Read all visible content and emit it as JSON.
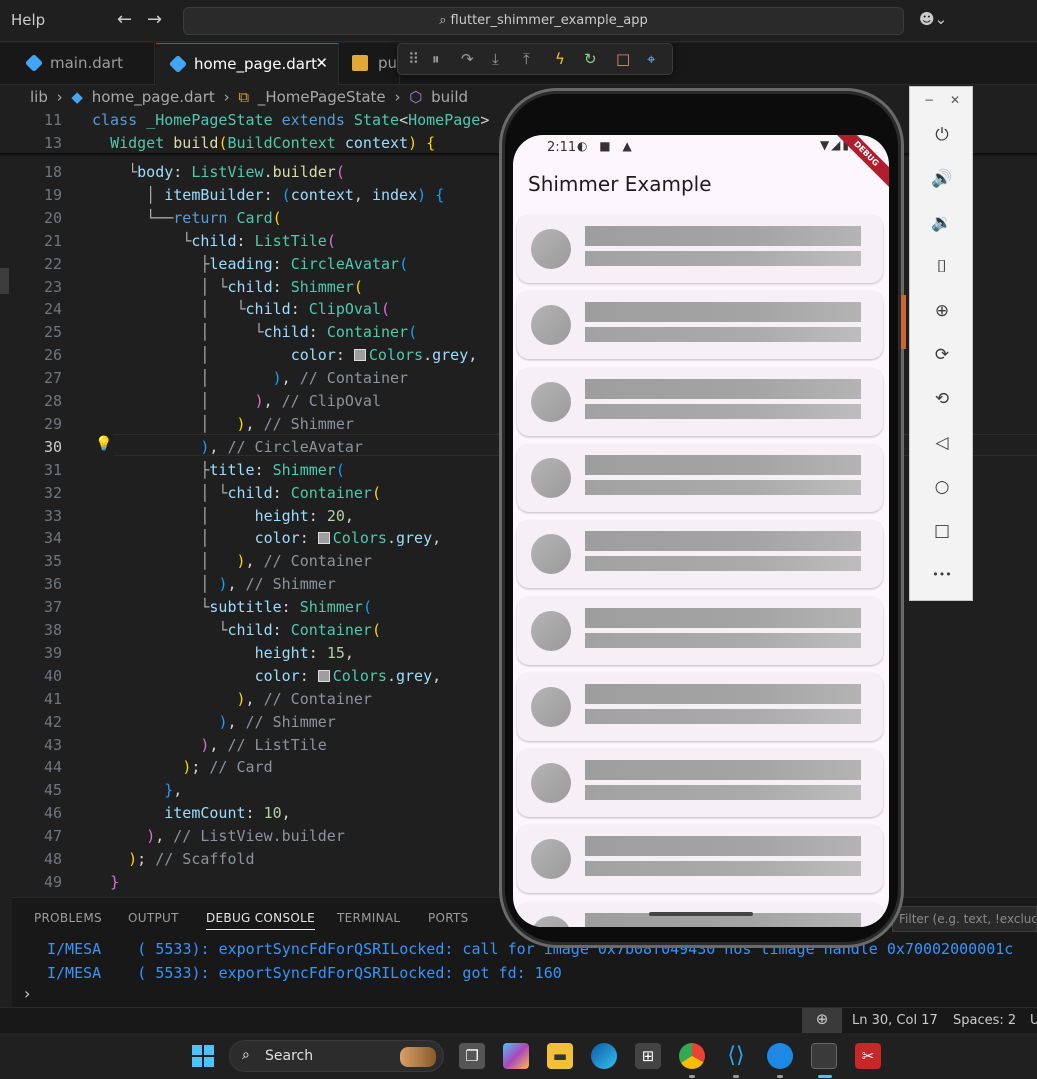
{
  "titlebar": {
    "menu_help": "Help",
    "back": "←",
    "forward": "→",
    "search_text": "flutter_shimmer_example_app",
    "copilot": "☻⌄"
  },
  "tabs": [
    {
      "label": "main.dart"
    },
    {
      "label": "home_page.dart",
      "close": "✕"
    },
    {
      "label": "pu"
    }
  ],
  "debug_toolbar": [
    "⠿",
    "⏸",
    "↷",
    "⤓",
    "⤒",
    "ϟ",
    "↻",
    "□",
    "⌖"
  ],
  "breadcrumb": [
    "lib",
    "›",
    "home_page.dart",
    "›",
    "_HomePageState",
    "›",
    "build"
  ],
  "sticky": [
    {
      "n": "11",
      "parts": [
        [
          "kw",
          "class "
        ],
        [
          "cls",
          "_HomePageState "
        ],
        [
          "kw",
          "extends "
        ],
        [
          "cls",
          "State"
        ],
        [
          "plain",
          "<"
        ],
        [
          "cls",
          "HomePage"
        ],
        [
          "plain",
          ">"
        ]
      ]
    },
    {
      "n": "13",
      "parts": [
        [
          "plain",
          "  "
        ],
        [
          "cls",
          "Widget "
        ],
        [
          "fn",
          "build"
        ],
        [
          "br1",
          "("
        ],
        [
          "cls",
          "BuildContext "
        ],
        [
          "prop",
          "context"
        ],
        [
          "br1",
          ")"
        ],
        [
          "plain",
          " "
        ],
        [
          "br1",
          "{"
        ]
      ]
    }
  ],
  "code_lines": [
    {
      "n": "18",
      "parts": [
        [
          "tree",
          "    └"
        ],
        [
          "prop",
          "body"
        ],
        [
          "plain",
          ": "
        ],
        [
          "cls",
          "ListView"
        ],
        [
          "plain",
          "."
        ],
        [
          "fn",
          "builder"
        ],
        [
          "br2",
          "("
        ]
      ]
    },
    {
      "n": "19",
      "parts": [
        [
          "tree",
          "      │ "
        ],
        [
          "prop",
          "itemBuilder"
        ],
        [
          "plain",
          ": "
        ],
        [
          "br3",
          "("
        ],
        [
          "prop",
          "context"
        ],
        [
          "plain",
          ", "
        ],
        [
          "prop",
          "index"
        ],
        [
          "br3",
          ")"
        ],
        [
          "plain",
          " "
        ],
        [
          "br3",
          "{"
        ]
      ]
    },
    {
      "n": "20",
      "parts": [
        [
          "tree",
          "      └──"
        ],
        [
          "kw",
          "return "
        ],
        [
          "cls",
          "Card"
        ],
        [
          "br1",
          "("
        ]
      ]
    },
    {
      "n": "21",
      "parts": [
        [
          "tree",
          "          └"
        ],
        [
          "prop",
          "child"
        ],
        [
          "plain",
          ": "
        ],
        [
          "cls",
          "ListTile"
        ],
        [
          "br2",
          "("
        ]
      ]
    },
    {
      "n": "22",
      "parts": [
        [
          "tree",
          "            ├"
        ],
        [
          "prop",
          "leading"
        ],
        [
          "plain",
          ": "
        ],
        [
          "cls",
          "CircleAvatar"
        ],
        [
          "br3",
          "("
        ]
      ]
    },
    {
      "n": "23",
      "parts": [
        [
          "tree",
          "            │ └"
        ],
        [
          "prop",
          "child"
        ],
        [
          "plain",
          ": "
        ],
        [
          "cls",
          "Shimmer"
        ],
        [
          "br1",
          "("
        ]
      ]
    },
    {
      "n": "24",
      "parts": [
        [
          "tree",
          "            │   └"
        ],
        [
          "prop",
          "child"
        ],
        [
          "plain",
          ": "
        ],
        [
          "cls",
          "ClipOval"
        ],
        [
          "br2",
          "("
        ]
      ]
    },
    {
      "n": "25",
      "parts": [
        [
          "tree",
          "            │     └"
        ],
        [
          "prop",
          "child"
        ],
        [
          "plain",
          ": "
        ],
        [
          "cls",
          "Container"
        ],
        [
          "br3",
          "("
        ]
      ]
    },
    {
      "n": "26",
      "parts": [
        [
          "tree",
          "            │         "
        ],
        [
          "prop",
          "color"
        ],
        [
          "plain",
          ": "
        ],
        [
          "swatch",
          ""
        ],
        [
          "cls",
          "Colors"
        ],
        [
          "plain",
          "."
        ],
        [
          "prop",
          "grey"
        ],
        [
          "plain",
          ","
        ]
      ]
    },
    {
      "n": "27",
      "parts": [
        [
          "tree",
          "            │       "
        ],
        [
          "br3",
          ")"
        ],
        [
          "plain",
          ", "
        ],
        [
          "cmt",
          "// Container"
        ]
      ]
    },
    {
      "n": "28",
      "parts": [
        [
          "tree",
          "            │     "
        ],
        [
          "br2",
          ")"
        ],
        [
          "plain",
          ", "
        ],
        [
          "cmt",
          "// ClipOval"
        ]
      ]
    },
    {
      "n": "29",
      "parts": [
        [
          "tree",
          "            │   "
        ],
        [
          "br1",
          ")"
        ],
        [
          "plain",
          ", "
        ],
        [
          "cmt",
          "// Shimmer"
        ]
      ]
    },
    {
      "n": "30",
      "parts": [
        [
          "tree",
          "            "
        ],
        [
          "br3",
          ")"
        ],
        [
          "plain",
          ", "
        ],
        [
          "cmt",
          "// CircleAvatar"
        ]
      ]
    },
    {
      "n": "31",
      "parts": [
        [
          "tree",
          "            ├"
        ],
        [
          "prop",
          "title"
        ],
        [
          "plain",
          ": "
        ],
        [
          "cls",
          "Shimmer"
        ],
        [
          "br3",
          "("
        ]
      ]
    },
    {
      "n": "32",
      "parts": [
        [
          "tree",
          "            │ └"
        ],
        [
          "prop",
          "child"
        ],
        [
          "plain",
          ": "
        ],
        [
          "cls",
          "Container"
        ],
        [
          "br1",
          "("
        ]
      ]
    },
    {
      "n": "33",
      "parts": [
        [
          "tree",
          "            │     "
        ],
        [
          "prop",
          "height"
        ],
        [
          "plain",
          ": "
        ],
        [
          "num",
          "20"
        ],
        [
          "plain",
          ","
        ]
      ]
    },
    {
      "n": "34",
      "parts": [
        [
          "tree",
          "            │     "
        ],
        [
          "prop",
          "color"
        ],
        [
          "plain",
          ": "
        ],
        [
          "swatch",
          ""
        ],
        [
          "cls",
          "Colors"
        ],
        [
          "plain",
          "."
        ],
        [
          "prop",
          "grey"
        ],
        [
          "plain",
          ","
        ]
      ]
    },
    {
      "n": "35",
      "parts": [
        [
          "tree",
          "            │   "
        ],
        [
          "br1",
          ")"
        ],
        [
          "plain",
          ", "
        ],
        [
          "cmt",
          "// Container"
        ]
      ]
    },
    {
      "n": "36",
      "parts": [
        [
          "tree",
          "            │ "
        ],
        [
          "br3",
          ")"
        ],
        [
          "plain",
          ", "
        ],
        [
          "cmt",
          "// Shimmer"
        ]
      ]
    },
    {
      "n": "37",
      "parts": [
        [
          "tree",
          "            └"
        ],
        [
          "prop",
          "subtitle"
        ],
        [
          "plain",
          ": "
        ],
        [
          "cls",
          "Shimmer"
        ],
        [
          "br3",
          "("
        ]
      ]
    },
    {
      "n": "38",
      "parts": [
        [
          "tree",
          "              └"
        ],
        [
          "prop",
          "child"
        ],
        [
          "plain",
          ": "
        ],
        [
          "cls",
          "Container"
        ],
        [
          "br1",
          "("
        ]
      ]
    },
    {
      "n": "39",
      "parts": [
        [
          "tree",
          "                  "
        ],
        [
          "prop",
          "height"
        ],
        [
          "plain",
          ": "
        ],
        [
          "num",
          "15"
        ],
        [
          "plain",
          ","
        ]
      ]
    },
    {
      "n": "40",
      "parts": [
        [
          "tree",
          "                  "
        ],
        [
          "prop",
          "color"
        ],
        [
          "plain",
          ": "
        ],
        [
          "swatch",
          ""
        ],
        [
          "cls",
          "Colors"
        ],
        [
          "plain",
          "."
        ],
        [
          "prop",
          "grey"
        ],
        [
          "plain",
          ","
        ]
      ]
    },
    {
      "n": "41",
      "parts": [
        [
          "tree",
          "                "
        ],
        [
          "br1",
          ")"
        ],
        [
          "plain",
          ", "
        ],
        [
          "cmt",
          "// Container"
        ]
      ]
    },
    {
      "n": "42",
      "parts": [
        [
          "tree",
          "              "
        ],
        [
          "br3",
          ")"
        ],
        [
          "plain",
          ", "
        ],
        [
          "cmt",
          "// Shimmer"
        ]
      ]
    },
    {
      "n": "43",
      "parts": [
        [
          "tree",
          "            "
        ],
        [
          "br2",
          ")"
        ],
        [
          "plain",
          ", "
        ],
        [
          "cmt",
          "// ListTile"
        ]
      ]
    },
    {
      "n": "44",
      "parts": [
        [
          "tree",
          "          "
        ],
        [
          "br1",
          ")"
        ],
        [
          "plain",
          "; "
        ],
        [
          "cmt",
          "// Card"
        ]
      ]
    },
    {
      "n": "45",
      "parts": [
        [
          "tree",
          "        "
        ],
        [
          "br3",
          "}"
        ],
        [
          "plain",
          ","
        ]
      ]
    },
    {
      "n": "46",
      "parts": [
        [
          "tree",
          "        "
        ],
        [
          "prop",
          "itemCount"
        ],
        [
          "plain",
          ": "
        ],
        [
          "num",
          "10"
        ],
        [
          "plain",
          ","
        ]
      ]
    },
    {
      "n": "47",
      "parts": [
        [
          "tree",
          "      "
        ],
        [
          "br2",
          ")"
        ],
        [
          "plain",
          ", "
        ],
        [
          "cmt",
          "// ListView.builder"
        ]
      ]
    },
    {
      "n": "48",
      "parts": [
        [
          "tree",
          "    "
        ],
        [
          "br1",
          ")"
        ],
        [
          "plain",
          "; "
        ],
        [
          "cmt",
          "// Scaffold"
        ]
      ]
    },
    {
      "n": "49",
      "parts": [
        [
          "tree",
          "  "
        ],
        [
          "br2",
          "}"
        ]
      ]
    }
  ],
  "panel": {
    "tabs": [
      "PROBLEMS",
      "OUTPUT",
      "DEBUG CONSOLE",
      "TERMINAL",
      "PORTS"
    ],
    "filter_placeholder": "Filter (e.g. text, !exclude, \\escape)",
    "logs": [
      "I/MESA    ( 5533): exportSyncFdForQSRILocked: call for image 0x7b08f049430 hos timage handle 0x70002000001c",
      "I/MESA    ( 5533): exportSyncFdForQSRILocked: got fd: 160"
    ],
    "prompt": "›"
  },
  "statusbar": {
    "zoom_icon": "⊕",
    "position": "Ln 30, Col 17",
    "spaces": "Spaces: 2",
    "encoding": "U"
  },
  "taskbar": {
    "search_label": "Search",
    "search_icon": "⌕"
  },
  "phone": {
    "time": "2:11",
    "status_icons": "◐ ■ ▲",
    "status_right": "▼◢▮",
    "debug": "DEBUG",
    "app_title": "Shimmer Example",
    "card_count": 10
  },
  "emulator_toolbar": {
    "minimize": "−",
    "close": "✕",
    "buttons": [
      {
        "name": "power-icon",
        "glyph": "⏻"
      },
      {
        "name": "volume-up-icon",
        "glyph": "🔊"
      },
      {
        "name": "volume-down-icon",
        "glyph": "🔉"
      },
      {
        "name": "camera-icon",
        "glyph": "⌷"
      },
      {
        "name": "zoom-icon",
        "glyph": "⊕"
      },
      {
        "name": "rotate-right-icon",
        "glyph": "⟳"
      },
      {
        "name": "rotate-left-icon",
        "glyph": "⟲"
      },
      {
        "name": "back-icon",
        "glyph": "◁"
      },
      {
        "name": "home-icon",
        "glyph": "○"
      },
      {
        "name": "overview-icon",
        "glyph": "□"
      },
      {
        "name": "more-icon",
        "glyph": "•••"
      }
    ]
  },
  "colors": {
    "editor_bg": "#1f1f1f",
    "accent": "#0078d4",
    "app_bg": "#fdf7fd",
    "shimmer_grey": "#9e9e9e"
  }
}
